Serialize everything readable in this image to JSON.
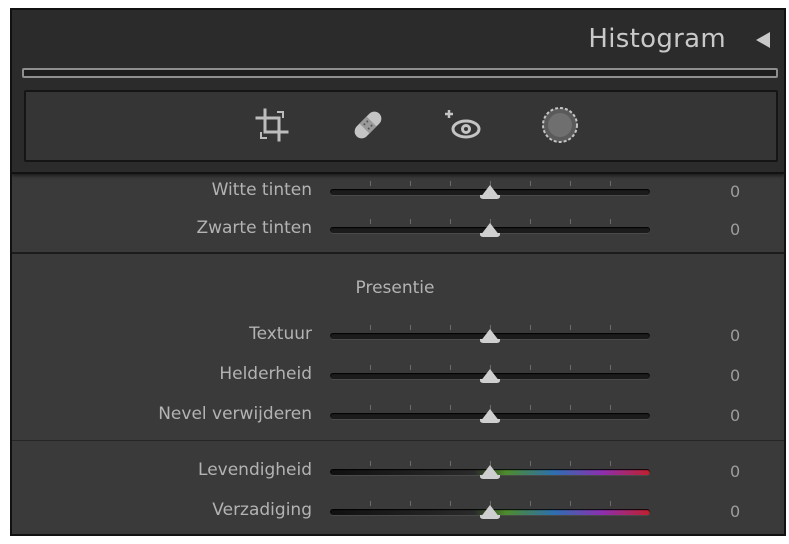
{
  "header": {
    "title": "Histogram",
    "collapse_icon": "triangle-left-icon"
  },
  "tools": [
    {
      "name": "crop-tool",
      "icon": "crop-icon"
    },
    {
      "name": "heal-tool",
      "icon": "bandage-icon"
    },
    {
      "name": "redeye-tool",
      "icon": "red-eye-icon"
    },
    {
      "name": "mask-tool",
      "icon": "masking-circle-icon"
    }
  ],
  "sliders_tone": [
    {
      "label": "Witte tinten",
      "value": "0",
      "position": 0.5
    },
    {
      "label": "Zwarte tinten",
      "value": "0",
      "position": 0.5
    }
  ],
  "presence": {
    "title": "Presentie",
    "sliders": [
      {
        "label": "Textuur",
        "value": "0",
        "position": 0.5
      },
      {
        "label": "Helderheid",
        "value": "0",
        "position": 0.5
      },
      {
        "label": "Nevel verwijderen",
        "value": "0",
        "position": 0.5
      }
    ],
    "color_sliders": [
      {
        "label": "Levendigheid",
        "value": "0",
        "position": 0.5
      },
      {
        "label": "Verzadiging",
        "value": "0",
        "position": 0.5
      }
    ]
  },
  "colors": {
    "panel_bg": "#3a3a3a",
    "header_bg": "#2b2b2b",
    "text": "#b3b3b3"
  }
}
